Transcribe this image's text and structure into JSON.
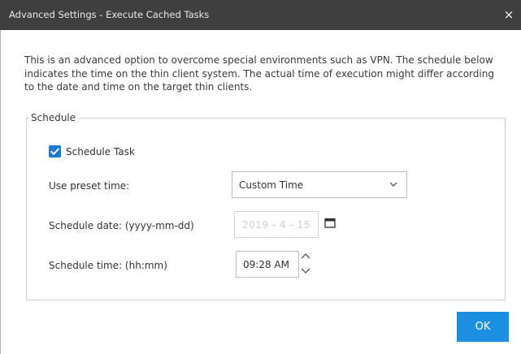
{
  "window": {
    "title": "Advanced Settings - Execute Cached Tasks",
    "close_glyph": "×"
  },
  "description": "This is an advanced option to overcome special environments such as VPN. The schedule below indicates the time on the thin client system. The actual time of execution might differ according to the date and time on the target thin clients.",
  "schedule": {
    "legend": "Schedule",
    "schedule_task": {
      "label": "Schedule Task",
      "checked": true
    },
    "preset": {
      "label": "Use preset time:",
      "value": "Custom Time"
    },
    "date": {
      "label": "Schedule date: (yyyy-mm-dd)",
      "value": "2019 - 4 - 15"
    },
    "time": {
      "label": "Schedule time: (hh:mm)",
      "value": "09:28 AM"
    }
  },
  "ok_button": {
    "label": "OK"
  },
  "colors": {
    "titlebar": "#3f3f3f",
    "accent": "#1c8fe0",
    "checkbox": "#1a78d6"
  },
  "icons": [
    "close-icon",
    "checkmark-icon",
    "chevron-down-icon",
    "calendar-icon",
    "spin-up-icon",
    "spin-down-icon"
  ]
}
